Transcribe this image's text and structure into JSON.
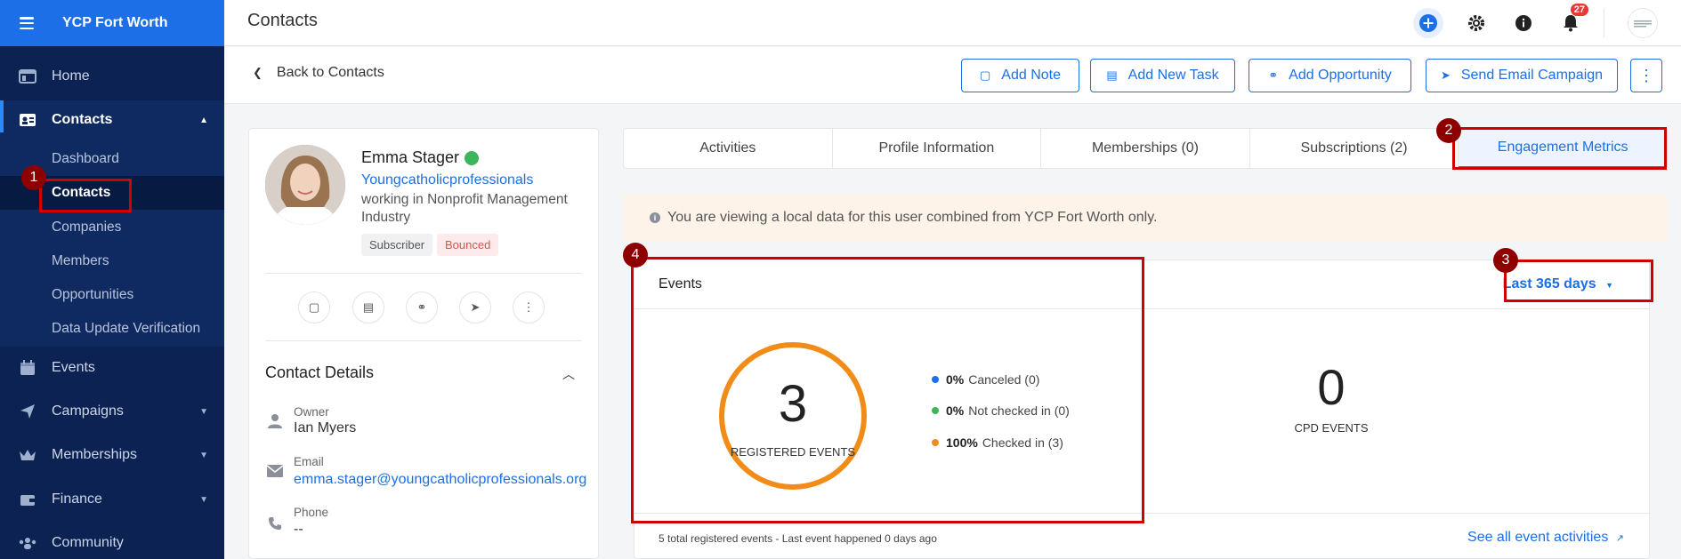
{
  "sidebar": {
    "org_name": "YCP Fort Worth",
    "items": [
      {
        "label": "Home",
        "icon": "home-icon"
      },
      {
        "label": "Contacts",
        "icon": "contacts-icon"
      },
      {
        "label": "Events",
        "icon": "calendar-icon"
      },
      {
        "label": "Campaigns",
        "icon": "send-icon"
      },
      {
        "label": "Memberships",
        "icon": "crown-icon"
      },
      {
        "label": "Finance",
        "icon": "wallet-icon"
      },
      {
        "label": "Community",
        "icon": "people-icon"
      }
    ],
    "contacts_sub": [
      "Dashboard",
      "Contacts",
      "Companies",
      "Members",
      "Opportunities",
      "Data Update Verification"
    ]
  },
  "topbar": {
    "title": "Contacts",
    "notification_count": "27"
  },
  "actionbar": {
    "back_label": "Back to Contacts",
    "buttons": [
      "Add Note",
      "Add New Task",
      "Add Opportunity",
      "Send Email Campaign"
    ]
  },
  "profile": {
    "name": "Emma Stager",
    "organization": "Youngcatholicprofessionals",
    "industry": "working in Nonprofit Management Industry",
    "badges": [
      "Subscriber",
      "Bounced"
    ],
    "contact_details_title": "Contact Details",
    "owner_label": "Owner",
    "owner_value": "Ian Myers",
    "email_label": "Email",
    "email_value": "emma.stager@youngcatholicprofessionals.org",
    "phone_label": "Phone",
    "phone_value": "--"
  },
  "tabs": [
    "Activities",
    "Profile Information",
    "Memberships (0)",
    "Subscriptions (2)",
    "Engagement Metrics"
  ],
  "banner": "You are viewing a local data for this user combined from YCP Fort Worth only.",
  "events": {
    "title": "Events",
    "period": "Last 365 days",
    "registered_count": "3",
    "registered_label": "REGISTERED EVENTS",
    "legend": [
      {
        "pct": "0%",
        "label": "Canceled (0)",
        "color": "#1c6fe6"
      },
      {
        "pct": "0%",
        "label": "Not checked in (0)",
        "color": "#3cb55c"
      },
      {
        "pct": "100%",
        "label": "Checked in (3)",
        "color": "#f28c18"
      }
    ],
    "cpd_count": "0",
    "cpd_label": "CPD EVENTS",
    "footer": "5 total registered events - Last event happened 0 days ago",
    "see_all": "See all event activities"
  },
  "annotations": [
    "1",
    "2",
    "3",
    "4"
  ]
}
